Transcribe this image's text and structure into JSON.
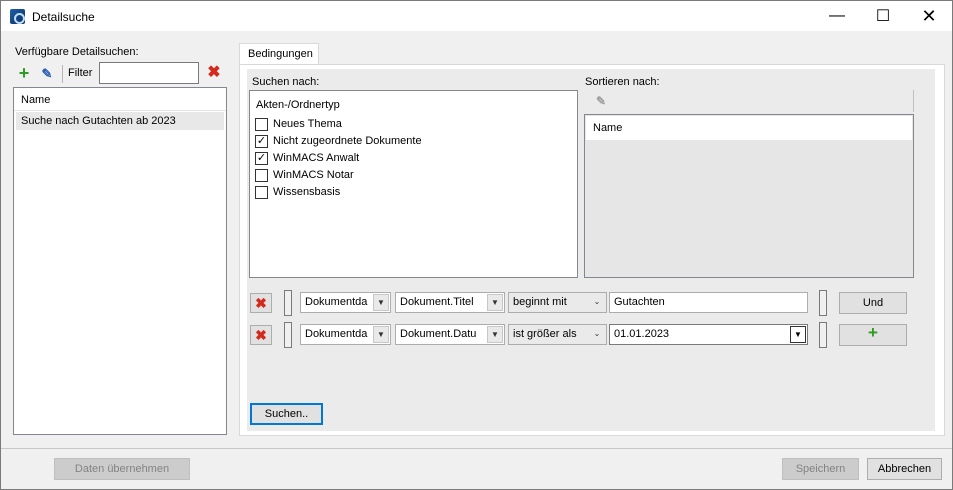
{
  "window": {
    "title": "Detailsuche"
  },
  "left": {
    "label": "Verfügbare Detailsuchen:",
    "filter_label": "Filter",
    "filter_value": "",
    "list_header": "Name",
    "items": [
      "Suche nach Gutachten ab 2023"
    ]
  },
  "tab": {
    "label": "Bedingungen"
  },
  "search": {
    "label": "Suchen nach:",
    "group_title": "Akten-/Ordnertyp",
    "options": [
      {
        "label": "Neues Thema",
        "checked": false,
        "mark": ""
      },
      {
        "label": "Nicht zugeordnete Dokumente",
        "checked": true,
        "mark": "✓"
      },
      {
        "label": "WinMACS Anwalt",
        "checked": true,
        "mark": "✓"
      },
      {
        "label": "WinMACS Notar",
        "checked": false,
        "mark": ""
      },
      {
        "label": "Wissensbasis",
        "checked": false,
        "mark": ""
      }
    ]
  },
  "sort": {
    "label": "Sortieren nach:",
    "header": "Name"
  },
  "conditions": [
    {
      "field1": "Dokumentda",
      "field2": "Dokument.Titel",
      "operator": "beginnt mit",
      "value": "Gutachten",
      "action": "Und"
    },
    {
      "field1": "Dokumentda",
      "field2": "Dokument.Datu",
      "operator": "ist größer als",
      "value": "01.01.2023",
      "action": ""
    }
  ],
  "buttons": {
    "search": "Suchen..",
    "apply": "Daten übernehmen",
    "save": "Speichern",
    "cancel": "Abbrechen"
  },
  "colors": {
    "focus": "#0078d7",
    "add": "#2e9c20",
    "delete": "#d42a1c"
  }
}
